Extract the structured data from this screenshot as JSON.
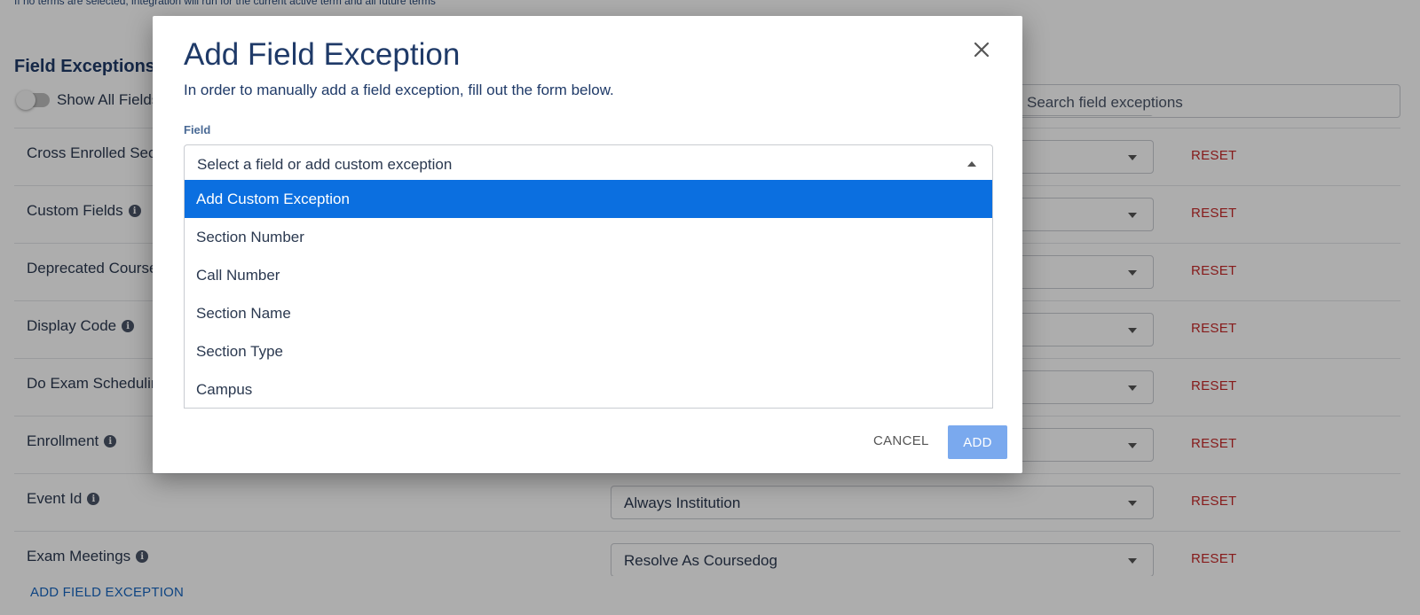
{
  "page": {
    "top_note": "If no terms are selected, integration will run for the current active term and all future terms",
    "section_title": "Field Exceptions",
    "toggle_label": "Show All Fields",
    "search_placeholder": "Search field exceptions",
    "reset_label": "RESET",
    "add_field_exception_label": "ADD FIELD EXCEPTION",
    "rows": [
      {
        "name": "",
        "has_info": false,
        "value": ""
      },
      {
        "name": "Cross Enrolled Sections",
        "has_info": false,
        "value": ""
      },
      {
        "name": "Custom Fields",
        "has_info": true,
        "value": ""
      },
      {
        "name": "Deprecated Course",
        "has_info": false,
        "value": ""
      },
      {
        "name": "Display Code",
        "has_info": true,
        "value": ""
      },
      {
        "name": "Do Exam Scheduling",
        "has_info": false,
        "value": ""
      },
      {
        "name": "Enrollment",
        "has_info": true,
        "value": ""
      },
      {
        "name": "Event Id",
        "has_info": true,
        "value": "Always Institution"
      },
      {
        "name": "Exam Meetings",
        "has_info": true,
        "value": "Resolve As Coursedog"
      }
    ]
  },
  "modal": {
    "title": "Add Field Exception",
    "description": "In order to manually add a field exception, fill out the form below.",
    "field_label": "Field",
    "field_placeholder": "Select a field or add custom exception",
    "options": [
      "Add Custom Exception",
      "Section Number",
      "Call Number",
      "Section Name",
      "Section Type",
      "Campus"
    ],
    "active_option_index": 0,
    "cancel_label": "CANCEL",
    "add_label": "ADD"
  },
  "colors": {
    "title": "#1f3a68",
    "reset": "#c62828",
    "link": "#1565c0",
    "option_active": "#0b6fe0",
    "add_button": "#7aa9ee"
  }
}
